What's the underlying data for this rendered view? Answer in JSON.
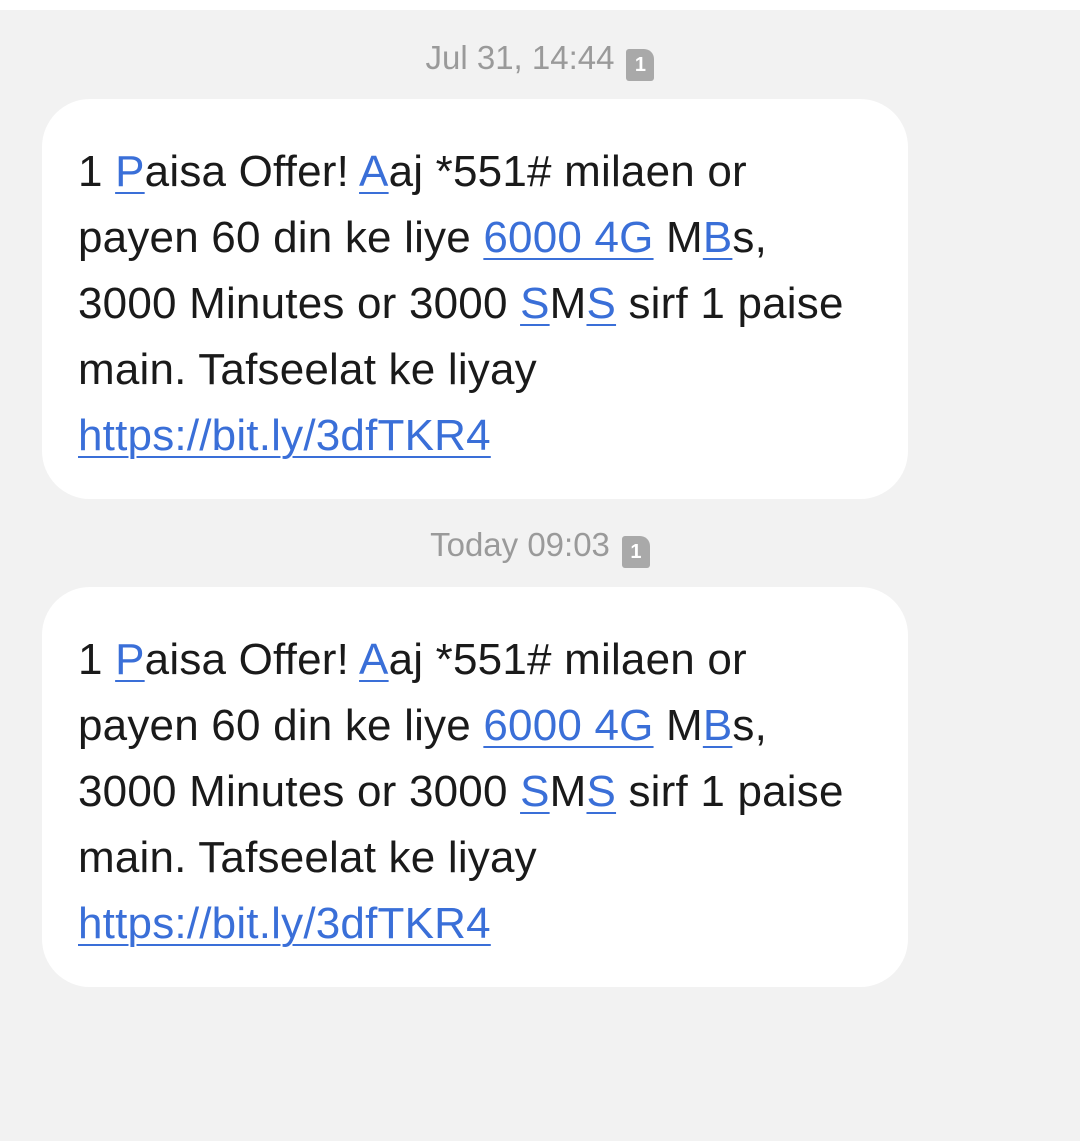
{
  "messages": [
    {
      "timestamp": "Jul 31, 14:44",
      "sim": "1",
      "body": {
        "t1": "1 ",
        "l1": "P",
        "t2": "aisa Offer! ",
        "l2": "A",
        "t3": "aj *551# milaen or payen 60 din ke liye ",
        "l3": "6000 4G",
        "t4": " M",
        "l4": "B",
        "t5": "s, 3000 Minutes or 3000 ",
        "l5": "S",
        "t6": "M",
        "l6": "S",
        "t7": " sirf 1 paise main. Tafseelat ke liyay ",
        "url": "https://bit.ly/3dfTKR4"
      }
    },
    {
      "timestamp": "Today 09:03",
      "sim": "1",
      "body": {
        "t1": "1 ",
        "l1": "P",
        "t2": "aisa Offer! ",
        "l2": "A",
        "t3": "aj *551# milaen or payen 60 din ke liye ",
        "l3": "6000 4G",
        "t4": " M",
        "l4": "B",
        "t5": "s, 3000 Minutes or 3000 ",
        "l5": "S",
        "t6": "M",
        "l6": "S",
        "t7": " sirf 1 paise main. Tafseelat ke liyay ",
        "url": "https://bit.ly/3dfTKR4"
      }
    }
  ],
  "colors": {
    "background": "#f2f2f2",
    "bubble": "#ffffff",
    "link": "#3a6fd8",
    "timestamp": "#9a9a9a",
    "text": "#1a1a1a"
  }
}
